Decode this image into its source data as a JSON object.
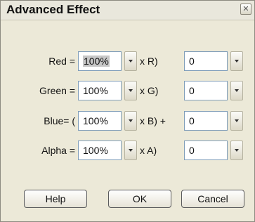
{
  "dialog": {
    "title": "Advanced Effect",
    "close_icon": "close-icon"
  },
  "rows": [
    {
      "label": "Red =",
      "percent": "100%",
      "mid_label": "x R)",
      "offset": "0"
    },
    {
      "label": "Green =",
      "percent": "100%",
      "mid_label": "x G)",
      "offset": "0"
    },
    {
      "label": "Blue= (",
      "percent": "100%",
      "mid_label": "x B) +",
      "offset": "0"
    },
    {
      "label": "Alpha =",
      "percent": "100%",
      "mid_label": "x A)",
      "offset": "0"
    }
  ],
  "buttons": {
    "help": "Help",
    "ok": "OK",
    "cancel": "Cancel"
  }
}
